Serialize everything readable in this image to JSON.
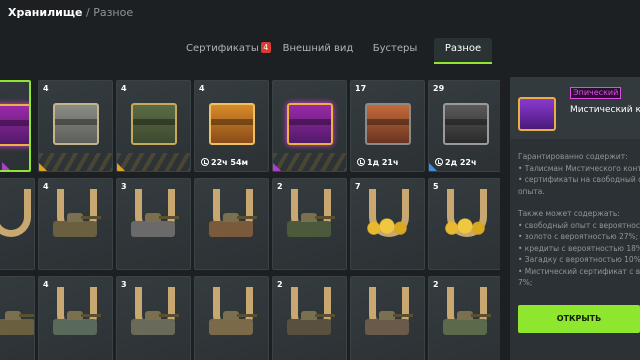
{
  "breadcrumb": {
    "main": "Хранилище",
    "sep": "/",
    "sub": "Разное"
  },
  "tabs": [
    {
      "label": "Сертификаты",
      "badge": "4"
    },
    {
      "label": "Внешний вид"
    },
    {
      "label": "Бустеры"
    },
    {
      "label": "Разное"
    }
  ],
  "grid": {
    "row1": [
      {
        "count": ""
      },
      {
        "count": "4"
      },
      {
        "count": "4"
      },
      {
        "count": "4",
        "timer": "22ч 54м"
      },
      {
        "count": ""
      },
      {
        "count": "17",
        "timer": "1д 21ч"
      },
      {
        "count": "29",
        "timer": "2д 22ч"
      }
    ],
    "row2": [
      {
        "count": ""
      },
      {
        "count": "4"
      },
      {
        "count": "3"
      },
      {
        "count": ""
      },
      {
        "count": "2"
      },
      {
        "count": "7"
      },
      {
        "count": "5"
      }
    ],
    "row3": [
      {
        "count": ""
      },
      {
        "count": "4"
      },
      {
        "count": "3"
      },
      {
        "count": ""
      },
      {
        "count": "2"
      },
      {
        "count": ""
      },
      {
        "count": "2"
      }
    ]
  },
  "panel": {
    "rarity": "Эпический",
    "title": "Мистический ко",
    "guaranteed_heading": "Гарантированно содержит:",
    "guaranteed": [
      "• Талисман Мистического конте",
      "• сертификаты на свободный о",
      "опыта."
    ],
    "maybe_heading": "Также может содержать:",
    "maybe": [
      "• свободный опыт с вероятност",
      "• золото с вероятностью 27%;",
      "• кредиты с вероятностью 18%",
      "• Загадку с вероятностью 10%;",
      "• Мистический сертификат с веро",
      "7%;"
    ],
    "open_label": "ОТКРЫТЬ"
  },
  "colors": {
    "accent": "#8fe62e",
    "epic": "#e24ae8",
    "badge": "#d83b32"
  }
}
